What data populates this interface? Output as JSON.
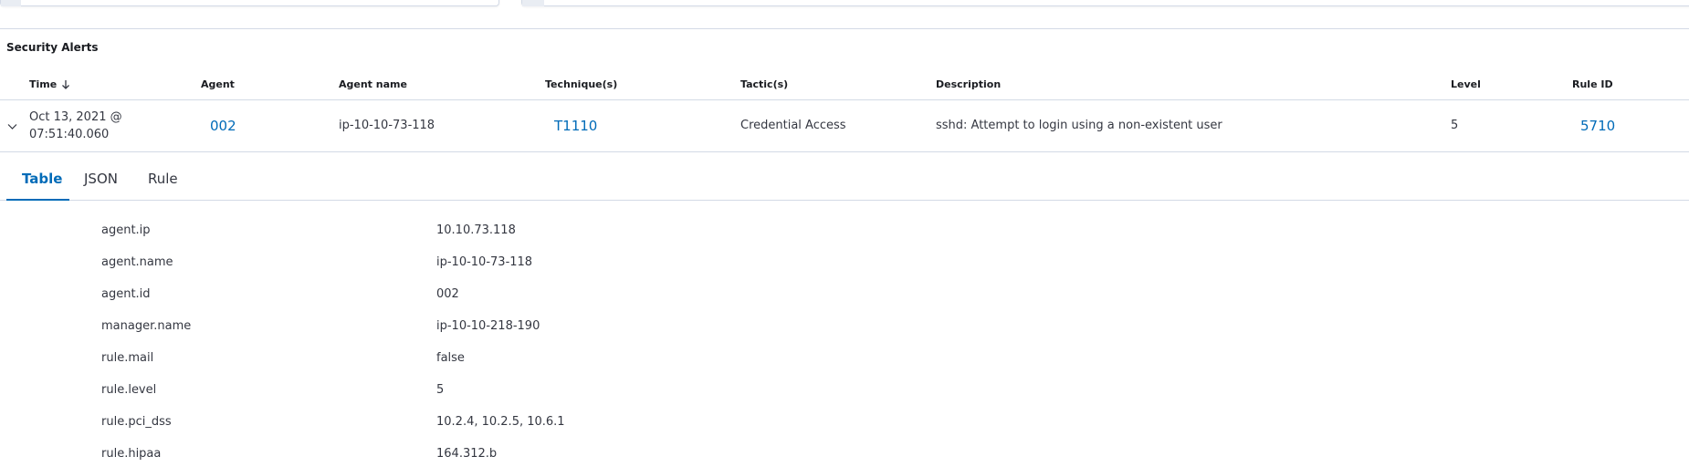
{
  "section": {
    "title": "Security Alerts"
  },
  "columns": {
    "time": "Time",
    "agent": "Agent",
    "agent_name": "Agent name",
    "techniques": "Technique(s)",
    "tactics": "Tactic(s)",
    "description": "Description",
    "level": "Level",
    "rule_id": "Rule ID"
  },
  "row": {
    "time_line1": "Oct 13, 2021 @",
    "time_line2": "07:51:40.060",
    "agent": "002",
    "agent_name": "ip-10-10-73-118",
    "technique": "T1110",
    "tactic": "Credential Access",
    "description": "sshd: Attempt to login using a non-existent user",
    "level": "5",
    "rule_id": "5710"
  },
  "tabs": {
    "table": "Table",
    "json": "JSON",
    "rule": "Rule"
  },
  "details": [
    {
      "key": "agent.ip",
      "value": "10.10.73.118"
    },
    {
      "key": "agent.name",
      "value": "ip-10-10-73-118"
    },
    {
      "key": "agent.id",
      "value": "002"
    },
    {
      "key": "manager.name",
      "value": "ip-10-10-218-190"
    },
    {
      "key": "rule.mail",
      "value": "false"
    },
    {
      "key": "rule.level",
      "value": "5"
    },
    {
      "key": "rule.pci_dss",
      "value": "10.2.4, 10.2.5, 10.6.1"
    },
    {
      "key": "rule.hipaa",
      "value": "164.312.b"
    }
  ],
  "colors": {
    "link": "#006bb8",
    "border": "#d3dae6",
    "text": "#343741"
  },
  "icons": {
    "sort": "arrow-down-icon",
    "expand": "chevron-down-icon"
  }
}
